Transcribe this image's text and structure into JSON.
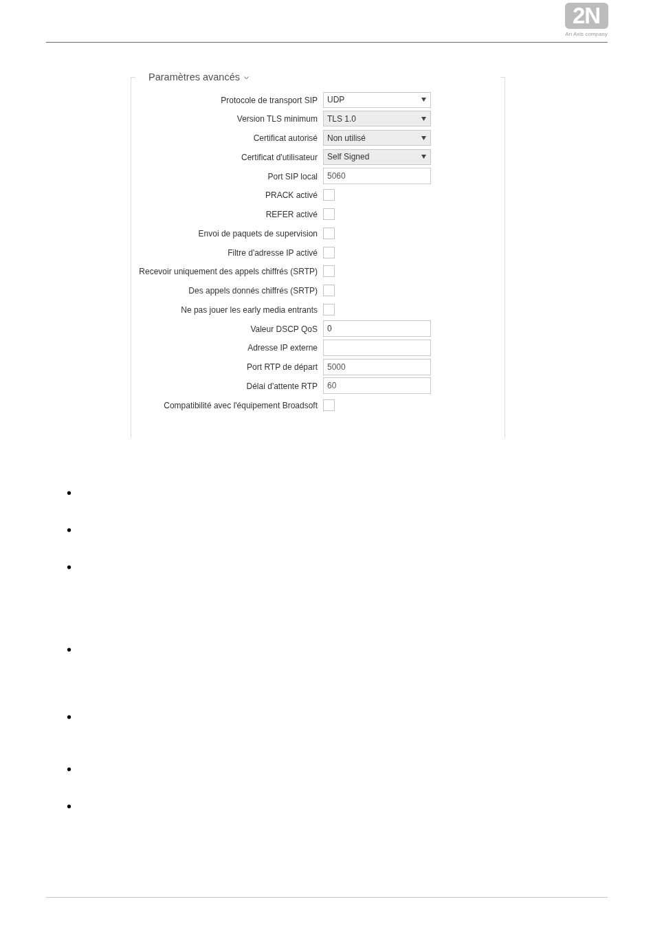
{
  "header": {
    "logo": {
      "text": "2N",
      "tagline": "An Axis company"
    }
  },
  "section": {
    "title": "Paramètres avancés",
    "expanded": true,
    "fields": [
      {
        "kind": "select",
        "label": "Protocole de transport SIP",
        "value": "UDP",
        "disabled": false
      },
      {
        "kind": "select",
        "label": "Version TLS minimum",
        "value": "TLS 1.0",
        "disabled": true
      },
      {
        "kind": "select",
        "label": "Certificat autorisé",
        "value": "Non utilisé",
        "disabled": true
      },
      {
        "kind": "select",
        "label": "Certificat d'utilisateur",
        "value": "Self Signed",
        "disabled": true
      },
      {
        "kind": "text",
        "label": "Port SIP local",
        "placeholder": "5060"
      },
      {
        "kind": "checkbox",
        "label": "PRACK activé",
        "checked": false
      },
      {
        "kind": "checkbox",
        "label": "REFER activé",
        "checked": false
      },
      {
        "kind": "checkbox",
        "label": "Envoi de paquets de supervision",
        "checked": false
      },
      {
        "kind": "checkbox",
        "label": "Filtre d'adresse IP activé",
        "checked": false
      },
      {
        "kind": "checkbox",
        "label": "Recevoir uniquement des appels chiffrés (SRTP)",
        "checked": false
      },
      {
        "kind": "checkbox",
        "label": "Des appels donnés chiffrés (SRTP)",
        "checked": false
      },
      {
        "kind": "checkbox",
        "label": "Ne pas jouer les early media entrants",
        "checked": false
      },
      {
        "kind": "text",
        "label": "Valeur DSCP QoS",
        "value": "0"
      },
      {
        "kind": "text",
        "label": "Adresse IP externe"
      },
      {
        "kind": "text",
        "label": "Port RTP de départ",
        "placeholder": "5000"
      },
      {
        "kind": "text",
        "label": "Délai d'attente RTP",
        "placeholder": "60"
      },
      {
        "kind": "checkbox",
        "label": "Compatibilité avec l'équipement Broadsoft",
        "checked": false
      }
    ]
  },
  "bullet_list": [
    {
      "marker": "•"
    },
    {
      "marker": "•"
    },
    {
      "marker": "•"
    },
    {
      "marker": "•"
    },
    {
      "marker": "•"
    },
    {
      "marker": "•"
    },
    {
      "marker": "•"
    }
  ]
}
